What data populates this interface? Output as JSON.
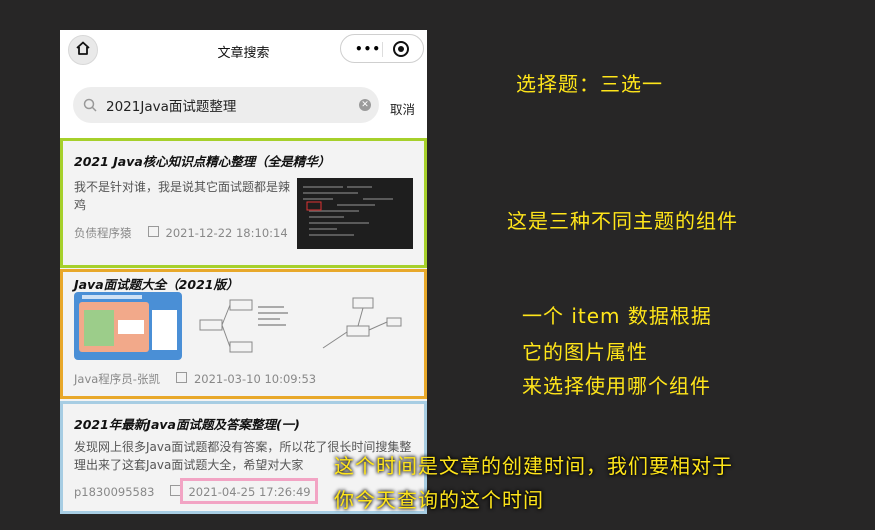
{
  "nav": {
    "title": "文章搜索",
    "capsule_dots": "•••"
  },
  "search": {
    "value": "2021Java面试题整理",
    "cancel_label": "取消"
  },
  "articles": [
    {
      "title": "2021 Java核心知识点精心整理（全是精华）",
      "description": "我不是针对谁，我是说其它面试题都是辣鸡",
      "author": "负债程序猿",
      "date": "2021-12-22 18:10:14"
    },
    {
      "title": "Java面试题大全（2021版）",
      "author": "Java程序员-张凯",
      "date": "2021-03-10 10:09:53"
    },
    {
      "title": "2021年最新Java面试题及答案整理(一)",
      "description": "发现网上很多Java面试题都没有答案，所以花了很长时间搜集整理出来了这套Java面试题大全，希望对大家",
      "author": "p1830095583",
      "date": "2021-04-25 17:26:49"
    }
  ],
  "annotations": {
    "choose": "选择题：三选一",
    "themes": "这是三种不同主题的组件",
    "item_line1": "一个 item 数据根据",
    "item_line2": "它的图片属性",
    "item_line3": "来选择使用哪个组件",
    "time_line1": "这个时间是文章的创建时间，我们要相对于",
    "time_line2": "你今天查询的这个时间"
  },
  "colors": {
    "card1_border": "#a6d02b",
    "card2_border": "#e8a82a",
    "card3_border": "#a7cde3",
    "date_highlight": "#f2a4c4",
    "annotation": "#ffe51a"
  }
}
